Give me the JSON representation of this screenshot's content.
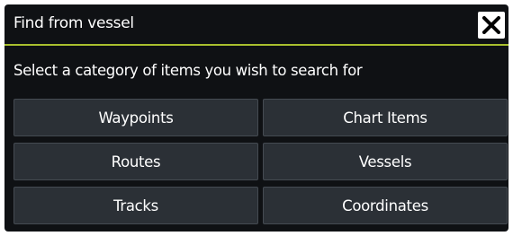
{
  "dialog": {
    "title": "Find from vessel",
    "close_icon": "close-icon",
    "prompt": "Select a category of items you wish to search for",
    "categories": [
      {
        "label": "Waypoints"
      },
      {
        "label": "Chart Items"
      },
      {
        "label": "Routes"
      },
      {
        "label": "Vessels"
      },
      {
        "label": "Tracks"
      },
      {
        "label": "Coordinates"
      }
    ]
  },
  "colors": {
    "background": "#0f1114",
    "button": "#2b3036",
    "accent_underline": "#a9bf2e",
    "text": "#ffffff"
  }
}
